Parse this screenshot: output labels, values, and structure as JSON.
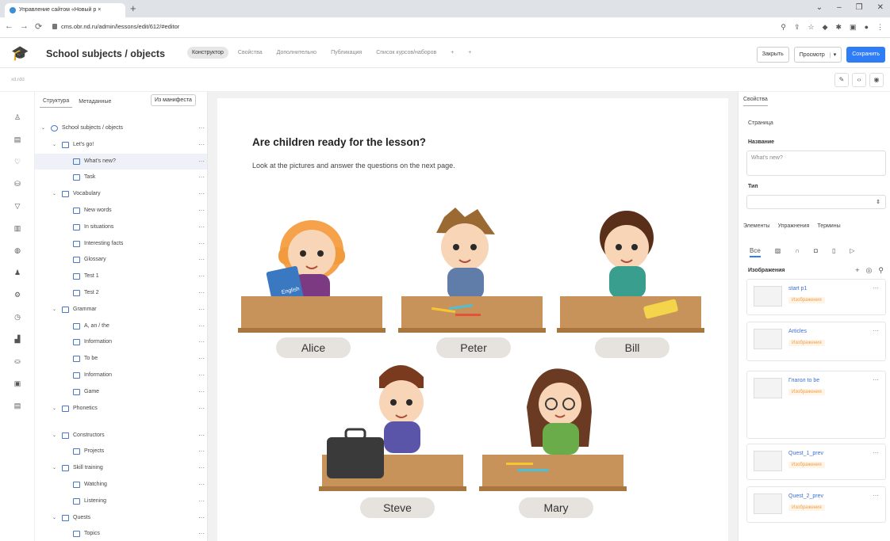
{
  "browser": {
    "tab_title": "Управление сайтом «Новый р ×",
    "url": "cms.obr.nd.ru/admin/lessons/edit/612/#editor"
  },
  "header": {
    "title": "School subjects / objects",
    "tabs": [
      "Конструктор",
      "Свойства",
      "Дополнительно",
      "Публикация",
      "Список курсов/наборов",
      "+",
      "+"
    ],
    "close_label": "Закрыть",
    "preview_label": "Просмотр",
    "save_label": "Сохранить"
  },
  "toolbar": {
    "label": "xd.rdd"
  },
  "tree": {
    "tabs": [
      "Структура",
      "Метаданные"
    ],
    "manifest_label": "Из манифеста",
    "items": [
      {
        "label": "School subjects / objects",
        "level": 0,
        "type": "root"
      },
      {
        "label": "Let's go!",
        "level": 1,
        "type": "folder"
      },
      {
        "label": "What's new?",
        "level": 2,
        "type": "page",
        "selected": true
      },
      {
        "label": "Task",
        "level": 2,
        "type": "page"
      },
      {
        "label": "Vocabulary",
        "level": 1,
        "type": "folder"
      },
      {
        "label": "New words",
        "level": 2,
        "type": "page"
      },
      {
        "label": "In situations",
        "level": 2,
        "type": "page"
      },
      {
        "label": "Interesting facts",
        "level": 2,
        "type": "page"
      },
      {
        "label": "Glossary",
        "level": 2,
        "type": "page"
      },
      {
        "label": "Test 1",
        "level": 2,
        "type": "page"
      },
      {
        "label": "Test 2",
        "level": 2,
        "type": "page"
      },
      {
        "label": "Grammar",
        "level": 1,
        "type": "folder"
      },
      {
        "label": "A, an / the",
        "level": 2,
        "type": "page"
      },
      {
        "label": "Information",
        "level": 2,
        "type": "page"
      },
      {
        "label": "To be",
        "level": 2,
        "type": "page"
      },
      {
        "label": "Information",
        "level": 2,
        "type": "page"
      },
      {
        "label": "Game",
        "level": 2,
        "type": "page"
      },
      {
        "label": "Phonetics",
        "level": 1,
        "type": "folder"
      },
      {
        "label": "Constructors",
        "level": 1,
        "type": "folder"
      },
      {
        "label": "Projects",
        "level": 2,
        "type": "page"
      },
      {
        "label": "Skill training",
        "level": 1,
        "type": "folder"
      },
      {
        "label": "Watching",
        "level": 2,
        "type": "page"
      },
      {
        "label": "Listening",
        "level": 2,
        "type": "page"
      },
      {
        "label": "Quests",
        "level": 1,
        "type": "folder"
      },
      {
        "label": "Topics",
        "level": 2,
        "type": "page"
      }
    ]
  },
  "lesson": {
    "title": "Are children ready for the lesson?",
    "subtitle": "Look at the pictures and answer the questions on the next page.",
    "book_label": "English",
    "students": [
      "Alice",
      "Peter",
      "Bill",
      "Steve",
      "Mary"
    ]
  },
  "properties": {
    "tab": "Свойства",
    "section": "Страница",
    "name_label": "Название",
    "name_value": "What's new?",
    "type_label": "Тип",
    "elements_tabs": [
      "Элементы",
      "Упражнения",
      "Термины"
    ],
    "filter_all": "Все",
    "images_label": "Изображения",
    "cards": [
      {
        "title": "start p1",
        "badge": "Изображения"
      },
      {
        "title": "Articles",
        "badge": "Изображения"
      },
      {
        "title": "Глагол to be",
        "badge": "Изображения"
      },
      {
        "title": "Quest_1_prev",
        "badge": "Изображения"
      },
      {
        "title": "Quest_2_prev",
        "badge": "Изображения"
      }
    ]
  },
  "colors": {
    "accent": "#2f7df6",
    "desk": "#c8935a",
    "pill": "#e6e3de"
  }
}
